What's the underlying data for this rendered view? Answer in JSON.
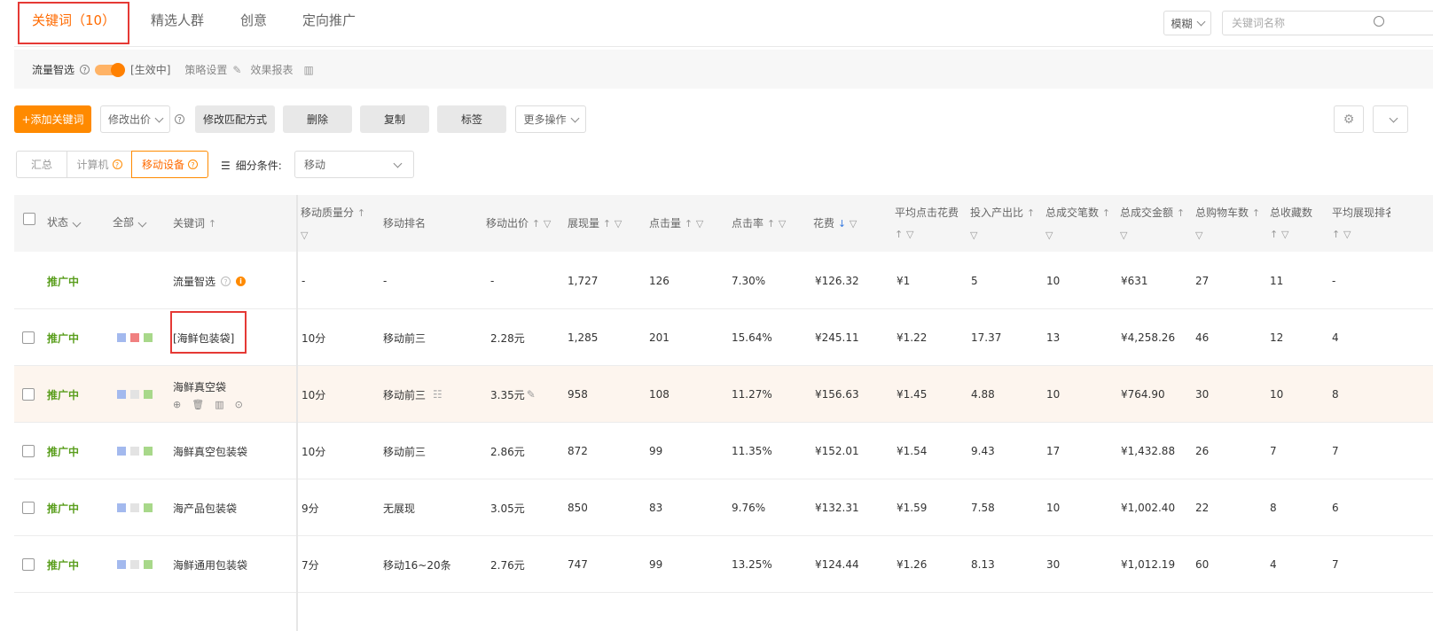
{
  "tabs": [
    {
      "label": "关键词（10）"
    },
    {
      "label": "精选人群"
    },
    {
      "label": "创意"
    },
    {
      "label": "定向推广"
    }
  ],
  "search": {
    "mode": "模糊",
    "placeholder": "关键词名称"
  },
  "flow_bar": {
    "label": "流量智选",
    "status": "[生效中]",
    "strategy": "策略设置",
    "report": "效果报表"
  },
  "toolbar": {
    "add": "+添加关键词",
    "edit_bid": "修改出价",
    "edit_match": "修改匹配方式",
    "delete": "删除",
    "copy": "复制",
    "tag": "标签",
    "more": "更多操作"
  },
  "segments": [
    {
      "label": "汇总"
    },
    {
      "label": "计算机"
    },
    {
      "label": "移动设备"
    }
  ],
  "breakdown": {
    "label": "细分条件:",
    "selected": "移动"
  },
  "headers": {
    "status": "状态",
    "all": "全部",
    "keyword": "关键词",
    "quality": "移动质量分",
    "rank": "移动排名",
    "bid": "移动出价",
    "impressions": "展现量",
    "clicks": "点击量",
    "ctr": "点击率",
    "cost": "花费",
    "cpc": "平均点击花费",
    "roi": "投入产出比",
    "orders": "总成交笔数",
    "gmv": "总成交金额",
    "cart": "总购物车数",
    "fav": "总收藏数",
    "avg_rank": "平均展现排名"
  },
  "rows": [
    {
      "status": "推广中",
      "keyword": "流量智选",
      "quality": "-",
      "rank": "-",
      "bid": "-",
      "impressions": "1,727",
      "clicks": "126",
      "ctr": "7.30%",
      "cost": "¥126.32",
      "cpc": "¥1",
      "roi": "5",
      "orders": "10",
      "gmv": "¥631",
      "cart": "27",
      "fav": "11",
      "avg_rank": "-"
    },
    {
      "status": "推广中",
      "keyword": "[海鲜包装袋]",
      "quality": "10分",
      "rank": "移动前三",
      "bid": "2.28元",
      "impressions": "1,285",
      "clicks": "201",
      "ctr": "15.64%",
      "cost": "¥245.11",
      "cpc": "¥1.22",
      "roi": "17.37",
      "orders": "13",
      "gmv": "¥4,258.26",
      "cart": "46",
      "fav": "12",
      "avg_rank": "4"
    },
    {
      "status": "推广中",
      "keyword": "海鲜真空袋",
      "quality": "10分",
      "rank": "移动前三",
      "bid": "3.35元",
      "impressions": "958",
      "clicks": "108",
      "ctr": "11.27%",
      "cost": "¥156.63",
      "cpc": "¥1.45",
      "roi": "4.88",
      "orders": "10",
      "gmv": "¥764.90",
      "cart": "30",
      "fav": "10",
      "avg_rank": "8"
    },
    {
      "status": "推广中",
      "keyword": "海鲜真空包装袋",
      "quality": "10分",
      "rank": "移动前三",
      "bid": "2.86元",
      "impressions": "872",
      "clicks": "99",
      "ctr": "11.35%",
      "cost": "¥152.01",
      "cpc": "¥1.54",
      "roi": "9.43",
      "orders": "17",
      "gmv": "¥1,432.88",
      "cart": "26",
      "fav": "7",
      "avg_rank": "7"
    },
    {
      "status": "推广中",
      "keyword": "海产品包装袋",
      "quality": "9分",
      "rank": "无展现",
      "bid": "3.05元",
      "impressions": "850",
      "clicks": "83",
      "ctr": "9.76%",
      "cost": "¥132.31",
      "cpc": "¥1.59",
      "roi": "7.58",
      "orders": "10",
      "gmv": "¥1,002.40",
      "cart": "22",
      "fav": "8",
      "avg_rank": "6"
    },
    {
      "status": "推广中",
      "keyword": "海鲜通用包装袋",
      "quality": "7分",
      "rank": "移动16~20条",
      "bid": "2.76元",
      "impressions": "747",
      "clicks": "99",
      "ctr": "13.25%",
      "cost": "¥124.44",
      "cpc": "¥1.26",
      "roi": "8.13",
      "orders": "30",
      "gmv": "¥1,012.19",
      "cart": "60",
      "fav": "4",
      "avg_rank": "7"
    }
  ],
  "colors": {
    "accent": "#ff6a00",
    "status_green": "#5a9e1d",
    "highlight_box": "#e53935",
    "row_highlight": "#fdf5ee"
  },
  "icons": [
    "help-icon",
    "pencil-icon",
    "bar-chart-icon",
    "settings-icon",
    "chevron-down-icon",
    "list-icon",
    "search-icon",
    "info-icon"
  ]
}
